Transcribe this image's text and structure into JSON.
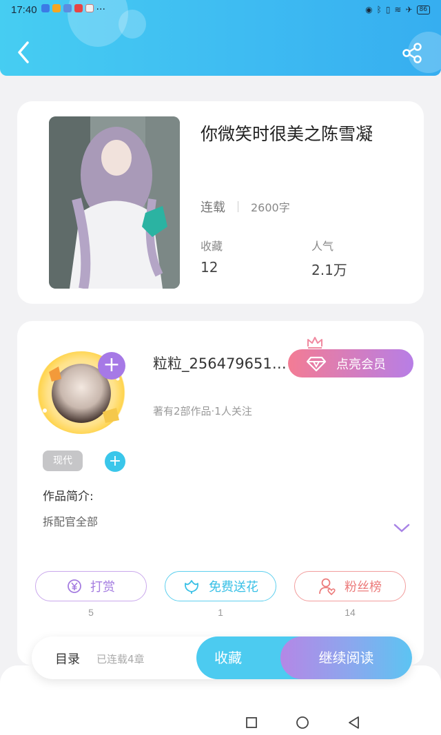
{
  "status_bar": {
    "time": "17:40",
    "battery": "86",
    "more": "···"
  },
  "book": {
    "title": "你微笑时很美之陈雪凝",
    "status": "连载",
    "words": "2600字",
    "favorites_label": "收藏",
    "favorites_value": "12",
    "popularity_label": "人气",
    "popularity_value": "2.1万"
  },
  "author": {
    "name": "粒粒_256479651…",
    "meta": "著有2部作品·1人关注",
    "follow_symbol": "+",
    "vip_label": "点亮会员",
    "tag": "现代",
    "tag_add_symbol": "+",
    "intro_label": "作品简介:",
    "intro_text": "拆配官全部"
  },
  "actions": {
    "reward_label": "打赏",
    "reward_count": "5",
    "flower_label": "免费送花",
    "flower_count": "1",
    "fans_label": "粉丝榜",
    "fans_count": "14"
  },
  "bottom": {
    "toc_label": "目录",
    "toc_meta": "已连载4章",
    "favorite_label": "收藏",
    "continue_label": "继续阅读"
  },
  "colors": {
    "header_start": "#46cdf2",
    "header_end": "#36aef0",
    "accent_purple": "#a679e6",
    "accent_cyan": "#38c0e6",
    "accent_pink": "#ec7b7b"
  },
  "icons": [
    "back-icon",
    "share-icon",
    "diamond-icon",
    "crown-icon",
    "yen-icon",
    "flower-icon",
    "user-heart-icon",
    "chevron-down-icon",
    "square-icon",
    "circle-icon",
    "triangle-back-icon"
  ]
}
